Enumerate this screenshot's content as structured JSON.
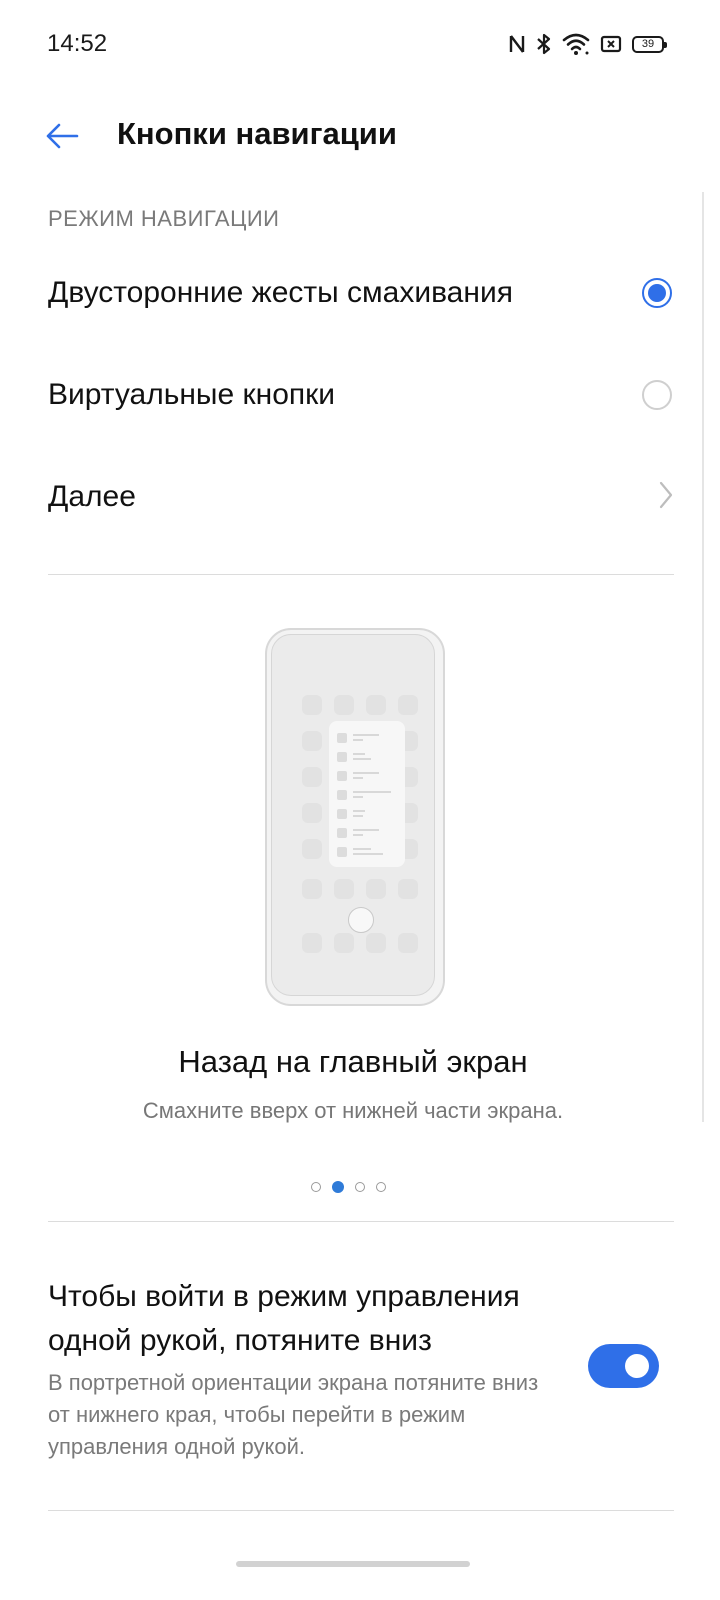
{
  "status_bar": {
    "time": "14:52",
    "battery": "39",
    "icons": [
      "nfc-icon",
      "bluetooth-icon",
      "wifi-icon",
      "sim-off-icon",
      "battery-icon"
    ]
  },
  "header": {
    "title": "Кнопки навигации",
    "back_icon": "back-arrow-icon"
  },
  "navigation_mode": {
    "section_title": "РЕЖИМ НАВИГАЦИИ",
    "options": [
      {
        "label": "Двусторонние жесты смахивания",
        "selected": true
      },
      {
        "label": "Виртуальные кнопки",
        "selected": false
      }
    ],
    "more_label": "Далее"
  },
  "gesture_demo": {
    "title": "Назад на главный экран",
    "description": "Смахните вверх от нижней части экрана.",
    "page_count": 4,
    "active_page": 2
  },
  "one_hand_mode": {
    "title": "Чтобы войти в режим управления одной рукой, потяните вниз",
    "description": "В портретной ориентации экрана потяните вниз от нижнего края, чтобы перейти в режим управления одной рукой.",
    "enabled": true
  },
  "colors": {
    "accent": "#2f6fe8",
    "text_primary": "#111111",
    "text_secondary": "#7a7a7a"
  }
}
